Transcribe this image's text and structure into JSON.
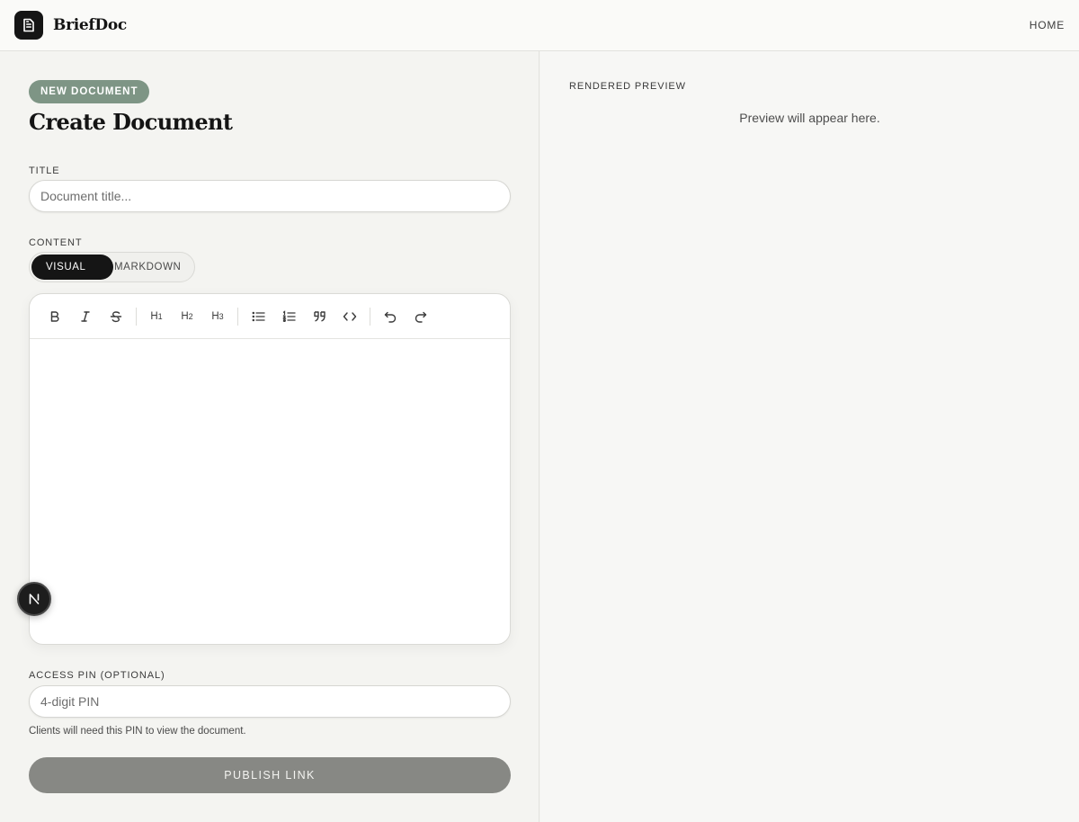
{
  "header": {
    "brand_name": "BriefDoc",
    "logo_icon": "document-icon",
    "nav_home": "HOME"
  },
  "editor_panel": {
    "badge": "NEW DOCUMENT",
    "page_title": "Create Document",
    "title_field": {
      "label": "TITLE",
      "placeholder": "Document title...",
      "value": ""
    },
    "content_field": {
      "label": "CONTENT",
      "modes": [
        "VISUAL",
        "MARKDOWN"
      ],
      "selected_mode": "VISUAL",
      "toolbar": [
        "bold-icon",
        "italic-icon",
        "strikethrough-icon",
        "heading-1-icon",
        "heading-2-icon",
        "heading-3-icon",
        "bullet-list-icon",
        "numbered-list-icon",
        "blockquote-icon",
        "code-icon",
        "undo-icon",
        "redo-icon"
      ],
      "value": ""
    },
    "pin_field": {
      "label": "ACCESS PIN (OPTIONAL)",
      "placeholder": "4-digit PIN",
      "value": "",
      "helper": "Clients will need this PIN to view the document."
    },
    "publish_label": "PUBLISH LINK"
  },
  "preview_panel": {
    "label": "RENDERED PREVIEW",
    "empty_text": "Preview will appear here."
  },
  "floating_badge_letter": "N",
  "colors": {
    "badge": "#7e9585",
    "primary_dark": "#151515",
    "publish_disabled": "#878884",
    "background": "#f4f4f1"
  }
}
